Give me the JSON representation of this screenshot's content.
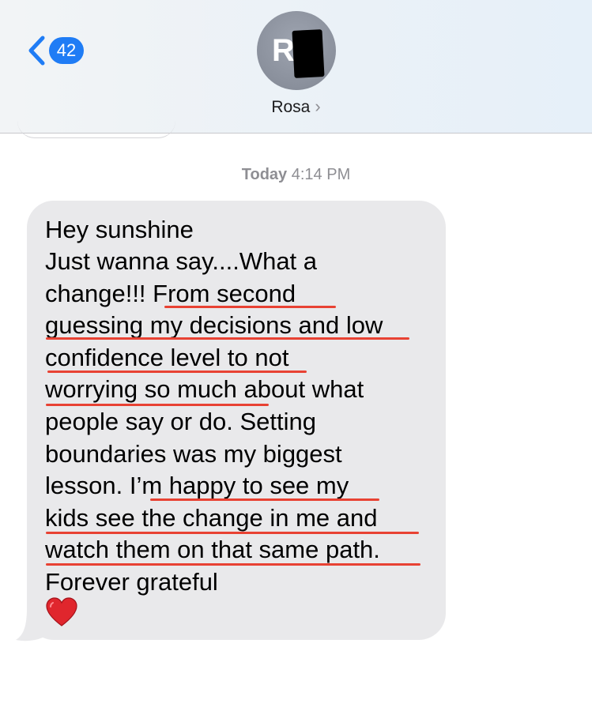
{
  "header": {
    "back_count": "42",
    "avatar_initial": "R",
    "contact_name": "Rosa",
    "contact_chevron": "›"
  },
  "timestamp": {
    "day": "Today",
    "time": "4:14 PM"
  },
  "message": {
    "lines": [
      "Hey sunshine",
      "Just wanna say....What a",
      "change!!! From second",
      "guessing my decisions and low",
      "confidence level to not",
      "worrying so much about what",
      "people say or do.  Setting",
      "boundaries was my biggest",
      "lesson.  I’m happy to see my",
      "kids see the change in me and",
      "watch them on that same path.",
      "Forever grateful"
    ],
    "emoji": "red-heart-icon"
  },
  "colors": {
    "badge": "#1f7cf5",
    "bubble": "#e9e9eb",
    "underline": "#e84233"
  }
}
